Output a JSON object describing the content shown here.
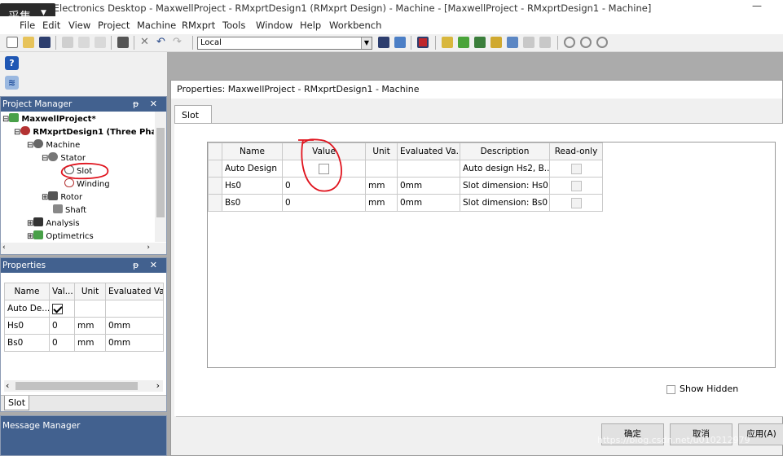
{
  "app": {
    "title": "ANSYS Electronics Desktop - MaxwellProject - RMxprtDesign1 (RMxprt Design) - Machine - [MaxwellProject - RMxprtDesign1 - Machine]",
    "minimize": "—",
    "overlay_label": "采集"
  },
  "menu": [
    "File",
    "Edit",
    "View",
    "Project",
    "Machine",
    "RMxprt",
    "Tools",
    "Window",
    "Help",
    "Workbench"
  ],
  "toolbar": {
    "local_select": "Local"
  },
  "project_manager": {
    "title": "Project Manager",
    "pin": "ᵽ ✕",
    "tree": [
      {
        "label": "MaxwellProject*",
        "bold": true
      },
      {
        "label": "RMxprtDesign1 (Three Phas",
        "bold": true
      },
      {
        "label": "Machine"
      },
      {
        "label": "Stator"
      },
      {
        "label": "Slot"
      },
      {
        "label": "Winding"
      },
      {
        "label": "Rotor"
      },
      {
        "label": "Shaft"
      },
      {
        "label": "Analysis"
      },
      {
        "label": "Optimetrics"
      }
    ]
  },
  "properties_panel": {
    "title": "Properties",
    "headers": [
      "Name",
      "Val...",
      "Unit",
      "Evaluated Va"
    ],
    "rows": [
      {
        "name": "Auto De...",
        "value": "",
        "unit": "",
        "evaluated": ""
      },
      {
        "name": "Hs0",
        "value": "0",
        "unit": "mm",
        "evaluated": "0mm"
      },
      {
        "name": "Bs0",
        "value": "0",
        "unit": "mm",
        "evaluated": "0mm"
      }
    ],
    "tab": "Slot"
  },
  "message_manager": {
    "title": "Message Manager"
  },
  "dialog": {
    "title": "Properties: MaxwellProject - RMxprtDesign1 - Machine",
    "tab": "Slot",
    "headers": [
      "Name",
      "Value",
      "Unit",
      "Evaluated Va...",
      "Description",
      "Read-only"
    ],
    "rows": [
      {
        "name": "Auto Design",
        "value": "",
        "unit": "",
        "evaluated": "",
        "description": "Auto design Hs2, B..."
      },
      {
        "name": "Hs0",
        "value": "0",
        "unit": "mm",
        "evaluated": "0mm",
        "description": "Slot dimension: Hs0"
      },
      {
        "name": "Bs0",
        "value": "0",
        "unit": "mm",
        "evaluated": "0mm",
        "description": "Slot dimension: Bs0"
      }
    ],
    "show_hidden": "Show Hidden",
    "ok": "确定",
    "cancel": "取消",
    "apply": "应用(A)"
  },
  "watermark": "https://blog.csdn.net/u010212979",
  "colors": {
    "panel_header": "#42618f",
    "annotation": "#e0141e"
  }
}
